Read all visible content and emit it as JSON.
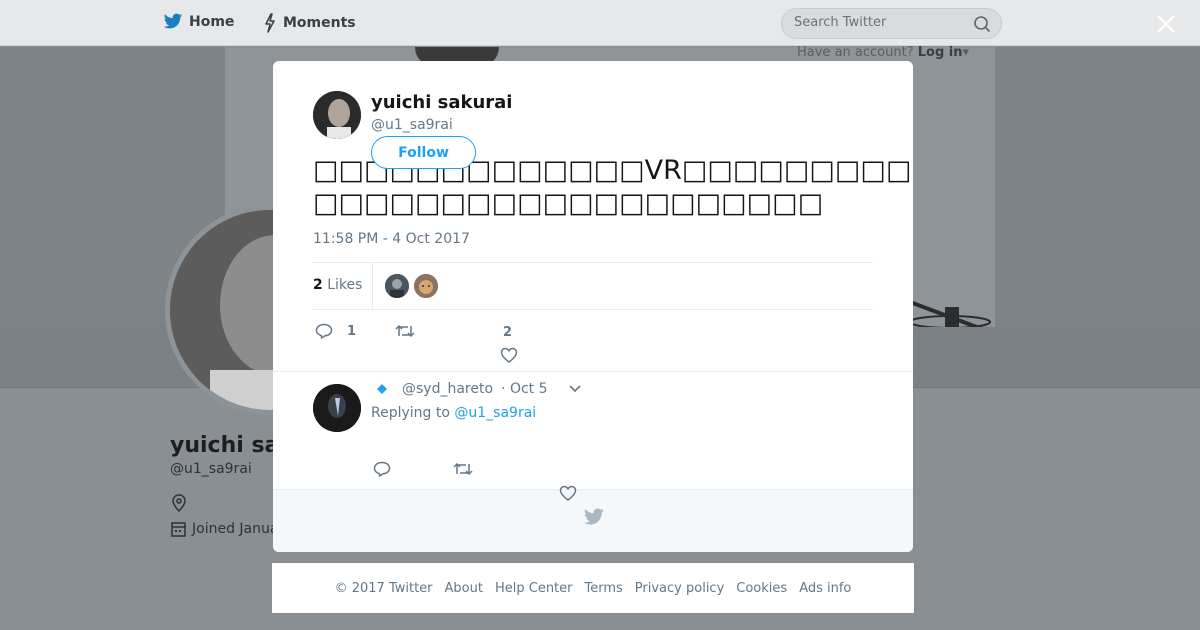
{
  "topbar": {
    "home_label": "Home",
    "moments_label": "Moments",
    "search_placeholder": "Search Twitter",
    "have_account": "Have an account?",
    "login_label": "Log in"
  },
  "profile": {
    "name": "yuichi sa",
    "handle": "@u1_sa9rai",
    "joined": "Joined Janua"
  },
  "tweet": {
    "author_name": "yuichi sakurai",
    "author_handle": "@u1_sa9rai",
    "follow_label": "Follow",
    "text_line1": "□□□□□□□□□□□□□VR□□□□□□□□□□□□□□□□□",
    "text_line2": "□□□□□□□□□□□□□□□□□□□□",
    "timestamp": "11:58 PM - 4 Oct 2017",
    "likes_count": "2",
    "likes_label": "Likes",
    "reply_count": "1",
    "retweet_count": "",
    "like_count": "2"
  },
  "reply": {
    "handle": "@syd_hareto",
    "date": "· Oct 5",
    "replying_prefix": "Replying to",
    "replying_to": "@u1_sa9rai"
  },
  "footer": {
    "copyright": "© 2017 Twitter",
    "links": [
      "About",
      "Help Center",
      "Terms",
      "Privacy policy",
      "Cookies",
      "Ads info"
    ]
  },
  "colors": {
    "accent": "#1da1f2",
    "text_primary": "#14171a",
    "text_secondary": "#657786"
  },
  "icons": [
    "twitter-bird-icon",
    "lightning-icon",
    "search-icon",
    "close-icon",
    "location-icon",
    "calendar-icon",
    "reply-icon",
    "retweet-icon",
    "heart-icon",
    "chevron-down-icon",
    "verified-diamond-icon"
  ]
}
